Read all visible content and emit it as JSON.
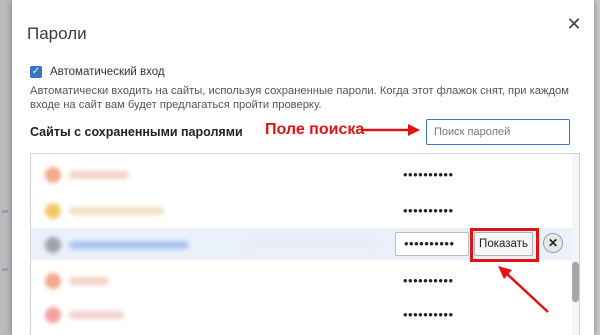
{
  "dialog": {
    "title": "Пароли",
    "close_label": "✕"
  },
  "auto_login": {
    "checked": true,
    "label": "Автоматический вход",
    "description": "Автоматически входить на сайты, используя сохраненные пароли. Когда этот флажок снят, при каждом входе на сайт вам будет предлагаться пройти проверку."
  },
  "saved_sites": {
    "heading": "Сайты с сохраненными паролями",
    "annotation": "Поле поиска",
    "search_placeholder": "Поиск паролей",
    "search_value": "",
    "rows": [
      {
        "password_mask": "••••••••••",
        "favicon_color": "#f2a98c",
        "site_color": "#f3d2c6"
      },
      {
        "password_mask": "••••••••••",
        "favicon_color": "#f4c76a",
        "site_color": "#f1dfc2"
      },
      {
        "password_mask": "••••••••••",
        "favicon_color": "#9ea3ab",
        "site_color": "#a9c3ee",
        "selected": true
      },
      {
        "password_mask": "••••••••••",
        "favicon_color": "#f2a98c",
        "site_color": "#f3d2c6"
      },
      {
        "password_mask": "••••••••••",
        "favicon_color": "#f2a0a0",
        "site_color": "#f3d0cf"
      }
    ],
    "show_button_label": "Показать",
    "remove_button_label": "✕"
  },
  "colors": {
    "accent": "#3b73c9",
    "annotation_red": "#e21212",
    "selected_row": "#eaf1fb"
  }
}
